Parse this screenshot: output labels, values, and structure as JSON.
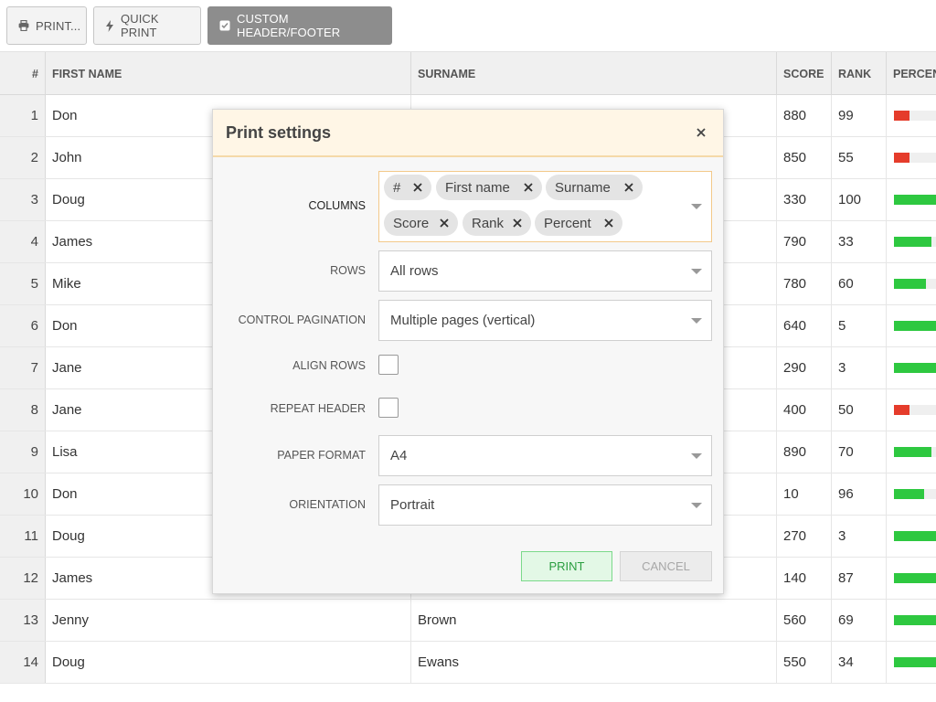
{
  "toolbar": {
    "print_label": "PRINT...",
    "quick_print_label": "QUICK PRINT",
    "custom_header_footer_label": "CUSTOM HEADER/FOOTER"
  },
  "grid": {
    "columns": [
      "#",
      "FIRST NAME",
      "SURNAME",
      "SCORE",
      "RANK",
      "PERCEN"
    ],
    "rows": [
      {
        "idx": "1",
        "first": "Don",
        "surname": "",
        "score": "880",
        "rank": "99",
        "percent": 0.28,
        "color": "#e53c2b"
      },
      {
        "idx": "2",
        "first": "John",
        "surname": "",
        "score": "850",
        "rank": "55",
        "percent": 0.28,
        "color": "#e53c2b"
      },
      {
        "idx": "3",
        "first": "Doug",
        "surname": "",
        "score": "330",
        "rank": "100",
        "percent": 1.0,
        "color": "#2ec840"
      },
      {
        "idx": "4",
        "first": "James",
        "surname": "",
        "score": "790",
        "rank": "33",
        "percent": 0.68,
        "color": "#2ec840"
      },
      {
        "idx": "5",
        "first": "Mike",
        "surname": "",
        "score": "780",
        "rank": "60",
        "percent": 0.58,
        "color": "#2ec840"
      },
      {
        "idx": "6",
        "first": "Don",
        "surname": "",
        "score": "640",
        "rank": "5",
        "percent": 1.0,
        "color": "#2ec840"
      },
      {
        "idx": "7",
        "first": "Jane",
        "surname": "",
        "score": "290",
        "rank": "3",
        "percent": 1.0,
        "color": "#2ec840"
      },
      {
        "idx": "8",
        "first": "Jane",
        "surname": "",
        "score": "400",
        "rank": "50",
        "percent": 0.28,
        "color": "#e53c2b"
      },
      {
        "idx": "9",
        "first": "Lisa",
        "surname": "",
        "score": "890",
        "rank": "70",
        "percent": 0.68,
        "color": "#2ec840"
      },
      {
        "idx": "10",
        "first": "Don",
        "surname": "",
        "score": "10",
        "rank": "96",
        "percent": 0.55,
        "color": "#2ec840"
      },
      {
        "idx": "11",
        "first": "Doug",
        "surname": "",
        "score": "270",
        "rank": "3",
        "percent": 1.0,
        "color": "#2ec840"
      },
      {
        "idx": "12",
        "first": "James",
        "surname": "",
        "score": "140",
        "rank": "87",
        "percent": 1.0,
        "color": "#2ec840"
      },
      {
        "idx": "13",
        "first": "Jenny",
        "surname": "Brown",
        "score": "560",
        "rank": "69",
        "percent": 1.0,
        "color": "#2ec840"
      },
      {
        "idx": "14",
        "first": "Doug",
        "surname": "Ewans",
        "score": "550",
        "rank": "34",
        "percent": 1.0,
        "color": "#2ec840"
      }
    ]
  },
  "dialog": {
    "title": "Print settings",
    "fields": {
      "columns_label": "COLUMNS",
      "column_tags": [
        "#",
        "First name",
        "Surname",
        "Score",
        "Rank",
        "Percent"
      ],
      "rows_label": "ROWS",
      "rows_value": "All rows",
      "pagination_label": "CONTROL PAGINATION",
      "pagination_value": "Multiple pages (vertical)",
      "align_rows_label": "ALIGN ROWS",
      "repeat_header_label": "REPEAT HEADER",
      "paper_format_label": "PAPER FORMAT",
      "paper_format_value": "A4",
      "orientation_label": "ORIENTATION",
      "orientation_value": "Portrait"
    },
    "print_button": "PRINT",
    "cancel_button": "CANCEL"
  },
  "colors": {
    "bar_low": "#e53c2b",
    "bar_high": "#2ec840",
    "accent_orange": "#f5d9a8",
    "print_green": "#2a9e3f"
  }
}
